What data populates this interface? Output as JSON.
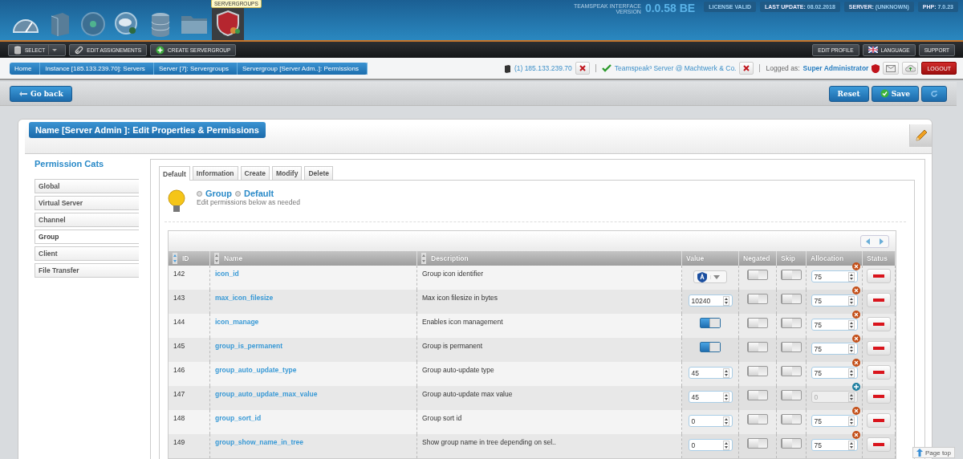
{
  "header": {
    "tooltip": "SERVERGROUPS",
    "nav": [
      {
        "selected": false
      },
      {
        "selected": false
      },
      {
        "selected": false
      },
      {
        "selected": false
      },
      {
        "selected": false
      },
      {
        "selected": false
      },
      {
        "selected": true
      }
    ],
    "version_label_1": "TEAMSPEAK INTERFACE",
    "version_label_2": "VERSION",
    "version": "0.0.58 BE",
    "badges": [
      {
        "kind": "plain",
        "label": "LICENSE VALID"
      },
      {
        "kind": "pair",
        "label": "LAST UPDATE:",
        "value": "08.02.2018"
      },
      {
        "kind": "pair",
        "label": "SERVER:",
        "value": "(UNKNOWN)"
      },
      {
        "kind": "pair",
        "label": "PHP:",
        "value": "7.0.23"
      }
    ]
  },
  "toolbar": {
    "left": [
      "SELECT",
      "EDIT ASSIGNEMENTS",
      "CREATE SERVERGROUP"
    ],
    "right": [
      "EDIT PROFILE",
      "LANGUAGE",
      "SUPPORT"
    ]
  },
  "breadcrumb": [
    "Home",
    "Instance [185.133.239.70]: Servers",
    "Server [7]: Servergroups",
    "Servergroup [Server Adm..]: Permissions"
  ],
  "session": {
    "instance": "(1) 185.133.239.70",
    "server": "Teamspeak³ Server @ Machtwerk & Co.",
    "logged_label": "Logged as:",
    "user": "Super Administrator",
    "logout": "LOGOUT"
  },
  "actions": {
    "back": "Go back",
    "reset": "Reset",
    "save": "Save"
  },
  "panel": {
    "title": "Name [Server Admin ]: Edit Properties & Permissions",
    "sidebar_title": "Permission Cats",
    "categories": [
      {
        "label": "Global",
        "selected": false
      },
      {
        "label": "Virtual Server",
        "selected": false
      },
      {
        "label": "Channel",
        "selected": false
      },
      {
        "label": "Group",
        "selected": true
      },
      {
        "label": "Client",
        "selected": false
      },
      {
        "label": "File Transfer",
        "selected": false
      }
    ],
    "tabs": [
      {
        "label": "Default",
        "selected": true
      },
      {
        "label": "Information",
        "selected": false
      },
      {
        "label": "Create",
        "selected": false
      },
      {
        "label": "Modify",
        "selected": false
      },
      {
        "label": "Delete",
        "selected": false
      }
    ],
    "crumbs": [
      "Group",
      "Default"
    ],
    "hint": "Edit permissions below as needed",
    "columns": [
      "ID",
      "Name",
      "Description",
      "Value",
      "Negated",
      "Skip",
      "Allocation",
      "Status"
    ],
    "rows": [
      {
        "id": "142",
        "name": "icon_id",
        "description": "Group icon identifier",
        "value": {
          "kind": "select"
        },
        "negated": false,
        "skip": false,
        "allocation": "75",
        "allocation_disabled": false
      },
      {
        "id": "143",
        "name": "max_icon_filesize",
        "description": "Max icon filesize in bytes",
        "value": {
          "kind": "number",
          "text": "10240"
        },
        "negated": false,
        "skip": false,
        "allocation": "75",
        "allocation_disabled": false
      },
      {
        "id": "144",
        "name": "icon_manage",
        "description": "Enables icon management",
        "value": {
          "kind": "toggle",
          "on": true
        },
        "negated": false,
        "skip": false,
        "allocation": "75",
        "allocation_disabled": false
      },
      {
        "id": "145",
        "name": "group_is_permanent",
        "description": "Group is permanent",
        "value": {
          "kind": "toggle",
          "on": true
        },
        "negated": false,
        "skip": false,
        "allocation": "75",
        "allocation_disabled": false
      },
      {
        "id": "146",
        "name": "group_auto_update_type",
        "description": "Group auto-update type",
        "value": {
          "kind": "number",
          "text": "45"
        },
        "negated": false,
        "skip": false,
        "allocation": "75",
        "allocation_disabled": false
      },
      {
        "id": "147",
        "name": "group_auto_update_max_value",
        "description": "Group auto-update max value",
        "value": {
          "kind": "number",
          "text": "45"
        },
        "negated": false,
        "skip": false,
        "allocation": "0",
        "allocation_disabled": true
      },
      {
        "id": "148",
        "name": "group_sort_id",
        "description": "Group sort id",
        "value": {
          "kind": "number",
          "text": "0"
        },
        "negated": false,
        "skip": false,
        "allocation": "75",
        "allocation_disabled": false
      },
      {
        "id": "149",
        "name": "group_show_name_in_tree",
        "description": "Show group name in tree depending on sel..",
        "value": {
          "kind": "number",
          "text": "0"
        },
        "negated": false,
        "skip": false,
        "allocation": "75",
        "allocation_disabled": false
      }
    ]
  },
  "page_top": "Page top"
}
